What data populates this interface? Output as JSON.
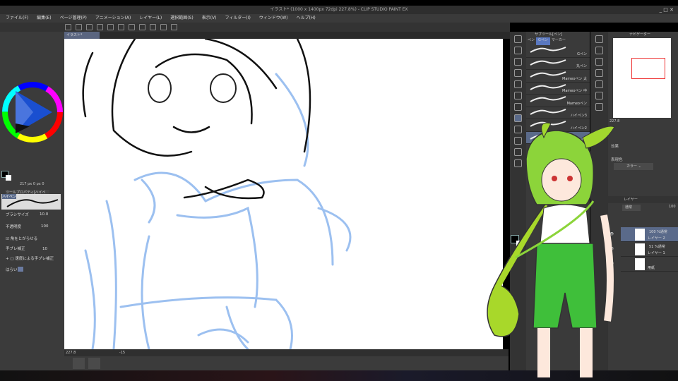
{
  "title": "イラスト* (1000 x 1400px 72dpi 227.8%)  - CLIP STUDIO PAINT EX",
  "window_controls": "_ □ ✕",
  "menu": [
    "ファイル(F)",
    "編集(E)",
    "ページ管理(P)",
    "アニメーション(A)",
    "レイヤー(L)",
    "選択範囲(S)",
    "表示(V)",
    "フィルター(I)",
    "ウィンドウ(W)",
    "ヘルプ(H)"
  ],
  "canvas_tab": "イラスト*",
  "left_panel": {
    "info": "217 px  0 px  0",
    "tool_property_title": "ツールプロパティ[ハイペン]",
    "brush_name": "ハイペン",
    "brush_size_label": "ブラシサイズ",
    "brush_size": "10.0",
    "opacity_label": "不透明度",
    "opacity": "100",
    "sharpen_label": "角をとがらせる",
    "sharpen_checked": true,
    "stabilization_label": "手ブレ補正",
    "stabilization": "10",
    "speed_stab_label": "速度による手ブレ補正",
    "taper_label": "はらい"
  },
  "subtool": {
    "title": "サブツール[ペン]",
    "tabs": [
      "ペン",
      "Gペン",
      "マーカー"
    ],
    "active_tab": 1,
    "brushes": [
      "Gペン",
      "丸ペン",
      "Mameoペン 太",
      "Mameoペン 中",
      "Mameoペン",
      "ハイペン3",
      "ハイペン2",
      "ハイペン",
      "ハイペン"
    ],
    "selected": 7
  },
  "navigator": {
    "title": "ナビゲーター",
    "zoom": "227.8"
  },
  "layer_property": {
    "effect_label": "効果",
    "expression_label": "表現色",
    "expression_value": "カラー"
  },
  "layers": {
    "title": "レイヤー",
    "blend": "通常",
    "opacity": "100",
    "items": [
      {
        "mode": "100 %通常",
        "name": "レイヤー 2",
        "selected": true
      },
      {
        "mode": "51 %通常",
        "name": "レイヤー 1",
        "selected": false
      },
      {
        "mode": "",
        "name": "用紙",
        "selected": false
      }
    ]
  },
  "status": {
    "zoom": "227.8",
    "angle": "-15"
  },
  "colors": {
    "accent": "#5a6a8a",
    "panel": "#3a3a3a",
    "sketch_blue": "#8fb8ee",
    "mascot_green": "#5cc83a"
  }
}
